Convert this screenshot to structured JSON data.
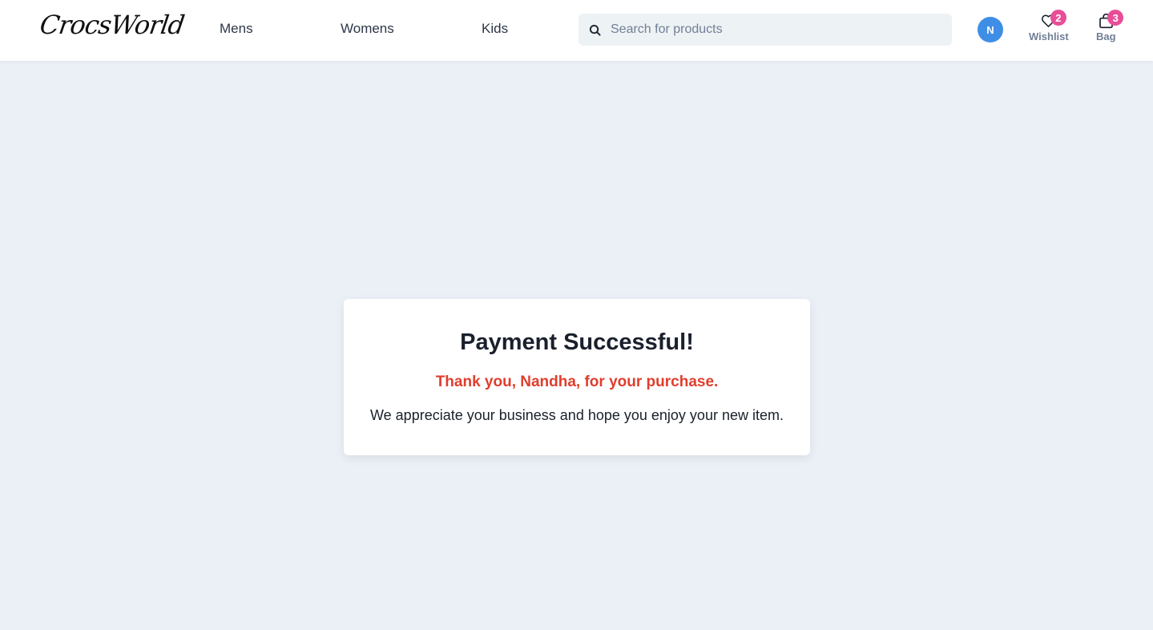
{
  "brand": {
    "logo_text": "CrocsWorld"
  },
  "nav": {
    "links": [
      {
        "label": "Mens"
      },
      {
        "label": "Womens"
      },
      {
        "label": "Kids"
      }
    ]
  },
  "search": {
    "placeholder": "Search for products",
    "value": ""
  },
  "user": {
    "avatar_initial": "N"
  },
  "actions": {
    "wishlist": {
      "label": "Wishlist",
      "count": "2",
      "icon": "heart-icon"
    },
    "bag": {
      "label": "Bag",
      "count": "3",
      "icon": "bag-icon"
    }
  },
  "confirmation": {
    "title": "Payment Successful!",
    "thanks": "Thank you, Nandha, for your purchase.",
    "message": "We appreciate your business and hope you enjoy your new item."
  },
  "colors": {
    "background": "#ebf0f7",
    "accent_red": "#e03e2d",
    "badge_pink": "#e84e97",
    "avatar_blue": "#3f8ee6"
  }
}
